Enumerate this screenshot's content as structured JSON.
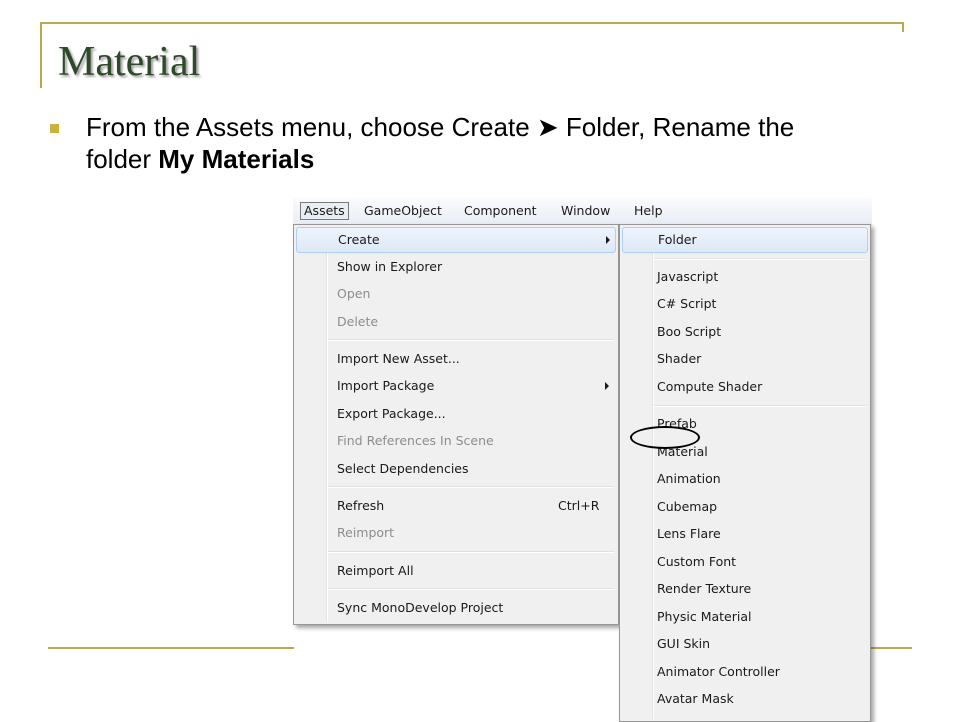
{
  "slide": {
    "title": "Material",
    "bullet_prefix": "From the Assets menu, choose Create ➤ Folder, Rename the folder ",
    "bullet_bold": "My Materials"
  },
  "menubar": {
    "items": [
      "Assets",
      "GameObject",
      "Component",
      "Window",
      "Help"
    ],
    "active": "Assets"
  },
  "assets_menu": {
    "items": [
      {
        "label": "Create",
        "state": "highlighted",
        "submenu": true
      },
      {
        "label": "Show in Explorer",
        "state": "enabled"
      },
      {
        "label": "Open",
        "state": "disabled"
      },
      {
        "label": "Delete",
        "state": "disabled"
      },
      {
        "label": "Import New Asset...",
        "state": "enabled"
      },
      {
        "label": "Import Package",
        "state": "enabled",
        "submenu": true
      },
      {
        "label": "Export Package...",
        "state": "enabled"
      },
      {
        "label": "Find References In Scene",
        "state": "disabled"
      },
      {
        "label": "Select Dependencies",
        "state": "enabled"
      },
      {
        "label": "Refresh",
        "state": "enabled",
        "shortcut": "Ctrl+R"
      },
      {
        "label": "Reimport",
        "state": "disabled"
      },
      {
        "label": "Reimport All",
        "state": "enabled"
      },
      {
        "label": "Sync MonoDevelop Project",
        "state": "enabled"
      }
    ]
  },
  "create_submenu": {
    "items": [
      {
        "label": "Folder",
        "state": "highlighted",
        "circled": true
      },
      {
        "label": "Javascript"
      },
      {
        "label": "C# Script"
      },
      {
        "label": "Boo Script"
      },
      {
        "label": "Shader"
      },
      {
        "label": "Compute Shader"
      },
      {
        "label": "Prefab"
      },
      {
        "label": "Material"
      },
      {
        "label": "Animation"
      },
      {
        "label": "Cubemap"
      },
      {
        "label": "Lens Flare"
      },
      {
        "label": "Custom Font"
      },
      {
        "label": "Render Texture"
      },
      {
        "label": "Physic Material"
      },
      {
        "label": "GUI Skin"
      },
      {
        "label": "Animator Controller"
      },
      {
        "label": "Avatar Mask"
      }
    ]
  },
  "colors": {
    "title": "#2f4a2a",
    "accent_rule": "#b8a94e",
    "bullet": "#c9b33b",
    "menu_highlight_border": "#aecff7",
    "disabled_text": "#8d8d8d"
  }
}
